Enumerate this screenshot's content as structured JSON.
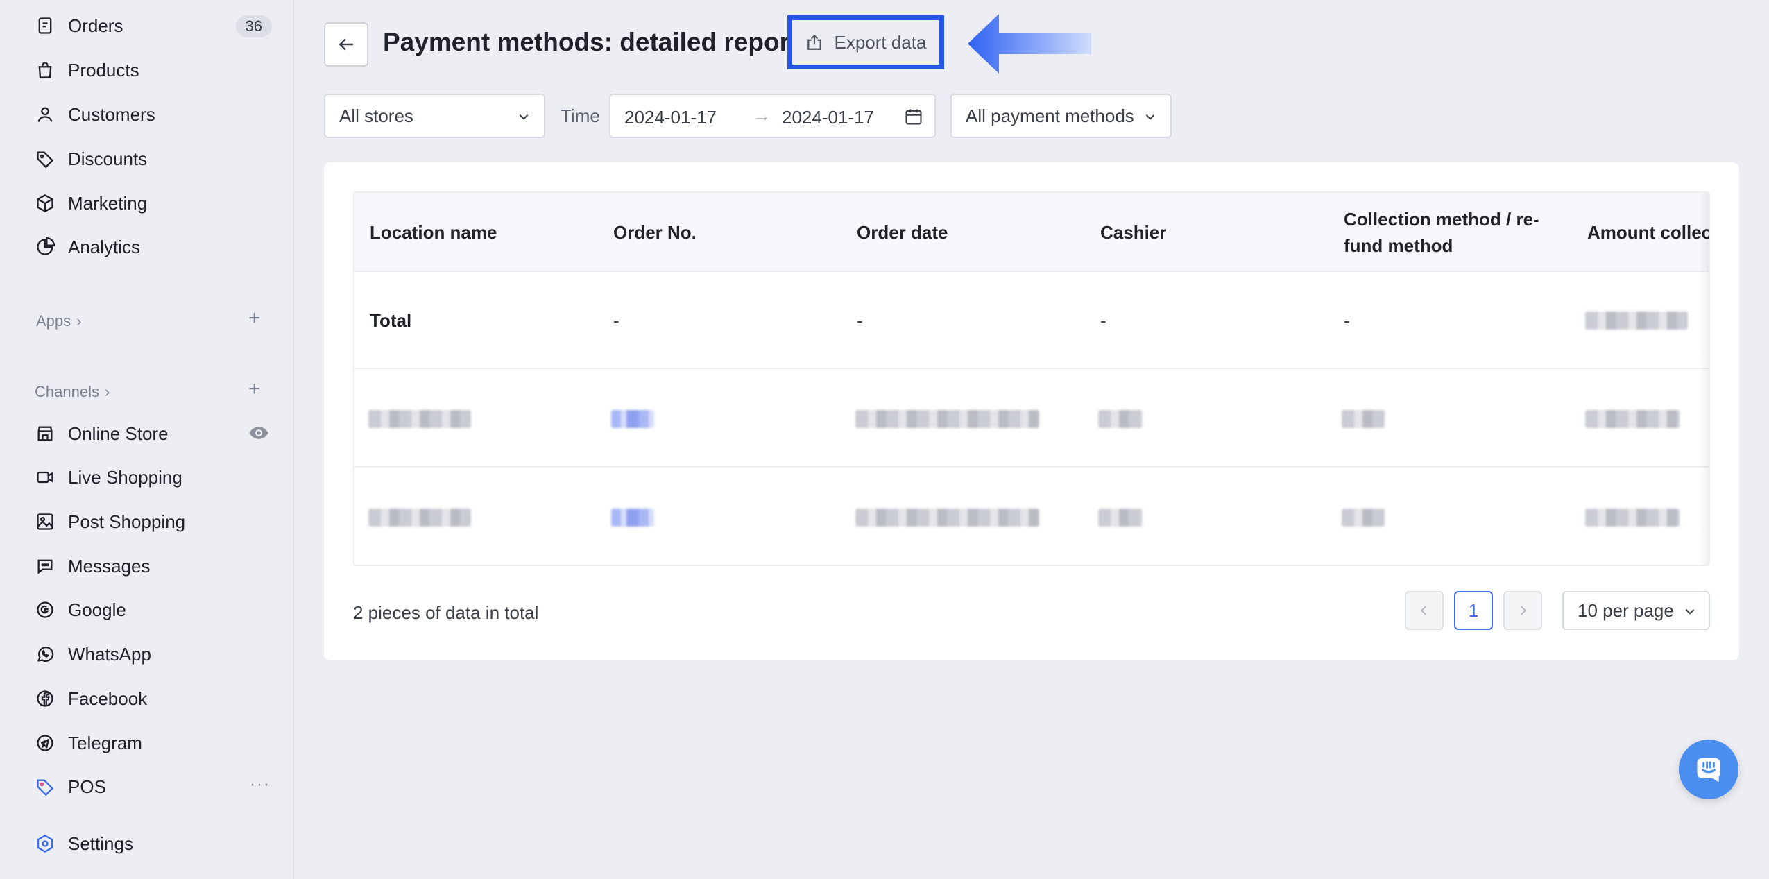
{
  "sidebar": {
    "items_top": [
      {
        "label": "Orders",
        "icon": "orders-icon",
        "badge": "36"
      },
      {
        "label": "Products",
        "icon": "bag-icon"
      },
      {
        "label": "Customers",
        "icon": "person-icon"
      },
      {
        "label": "Discounts",
        "icon": "tag-icon"
      },
      {
        "label": "Marketing",
        "icon": "box-icon"
      },
      {
        "label": "Analytics",
        "icon": "pie-chart-icon"
      }
    ],
    "apps_label": "Apps",
    "channels_label": "Channels",
    "channels": [
      {
        "label": "Online Store",
        "icon": "store-icon"
      },
      {
        "label": "Live Shopping",
        "icon": "video-icon"
      },
      {
        "label": "Post Shopping",
        "icon": "image-icon"
      },
      {
        "label": "Messages",
        "icon": "chat-icon"
      },
      {
        "label": "Google",
        "icon": "google-icon"
      },
      {
        "label": "WhatsApp",
        "icon": "whatsapp-icon"
      },
      {
        "label": "Facebook",
        "icon": "facebook-icon"
      },
      {
        "label": "Telegram",
        "icon": "telegram-icon"
      },
      {
        "label": "POS",
        "icon": "pos-icon"
      }
    ],
    "settings_label": "Settings"
  },
  "header": {
    "title": "Payment methods: detailed report",
    "export_label": "Export data"
  },
  "filters": {
    "store": "All stores",
    "time_label": "Time",
    "date_from": "2024-01-17",
    "date_to": "2024-01-17",
    "payment_method": "All payment methods"
  },
  "table": {
    "columns": [
      "Location name",
      "Order No.",
      "Order date",
      "Cashier",
      "Collection method / re-\nfund method",
      "Amount collect"
    ],
    "total_row": [
      "Total",
      "-",
      "-",
      "-",
      "-"
    ]
  },
  "pagination": {
    "summary": "2 pieces of data in total",
    "current_page": "1",
    "per_page": "10 per page"
  },
  "colors": {
    "accent": "#3d6bf0",
    "highlight_border": "#2755e8",
    "background": "#eceef3"
  }
}
